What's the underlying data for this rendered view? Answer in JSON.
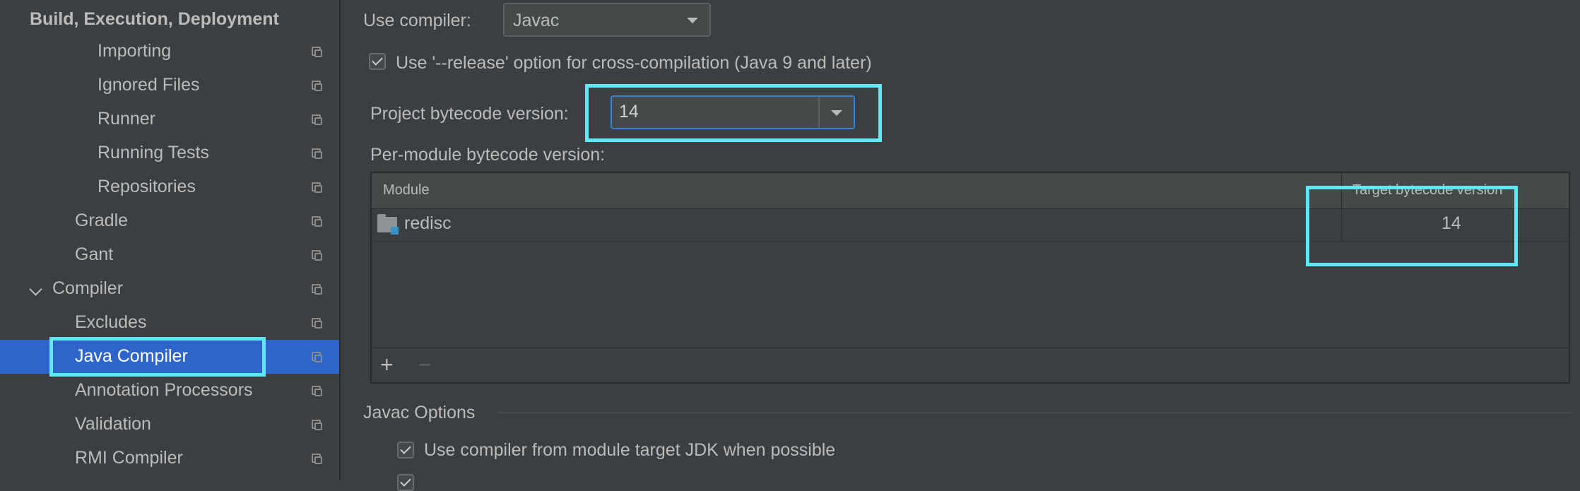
{
  "sidebar": {
    "section_title": "Build, Execution, Deployment",
    "items": [
      {
        "label": "Importing"
      },
      {
        "label": "Ignored Files"
      },
      {
        "label": "Runner"
      },
      {
        "label": "Running Tests"
      },
      {
        "label": "Repositories"
      },
      {
        "label": "Gradle"
      },
      {
        "label": "Gant"
      },
      {
        "label": "Compiler"
      },
      {
        "label": "Excludes"
      },
      {
        "label": "Java Compiler"
      },
      {
        "label": "Annotation Processors"
      },
      {
        "label": "Validation"
      },
      {
        "label": "RMI Compiler"
      }
    ],
    "selected": "Java Compiler"
  },
  "main": {
    "use_compiler_label": "Use compiler:",
    "use_compiler_value": "Javac",
    "release_option_label": "Use '--release' option for cross-compilation (Java 9 and later)",
    "project_bytecode_label": "Project bytecode version:",
    "project_bytecode_value": "14",
    "per_module_label": "Per-module bytecode version:",
    "table": {
      "columns": [
        "Module",
        "Target bytecode version"
      ],
      "rows": [
        {
          "module": "redisc",
          "version": "14"
        }
      ],
      "add_label": "+",
      "remove_label": "−"
    },
    "javac_options_title": "Javac Options",
    "use_module_jdk_label": "Use compiler from module target JDK when possible"
  },
  "colors": {
    "background": "#3c3f41",
    "selection": "#2f65ca",
    "highlight": "#5fe8f4",
    "focus_border": "#3d7fd1"
  }
}
